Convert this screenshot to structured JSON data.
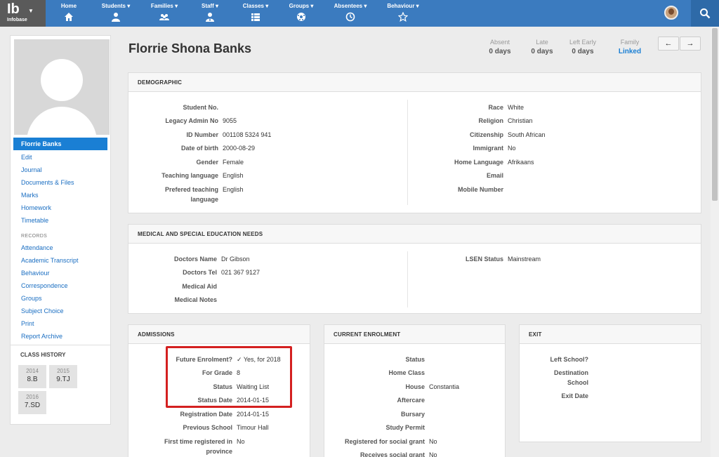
{
  "app": {
    "logo": "Ib",
    "logo_sub": "Infobase"
  },
  "nav": [
    {
      "label": "Home",
      "icon": "home-icon"
    },
    {
      "label": "Students ▾",
      "icon": "user-icon"
    },
    {
      "label": "Families ▾",
      "icon": "family-icon"
    },
    {
      "label": "Staff ▾",
      "icon": "staff-icon"
    },
    {
      "label": "Classes ▾",
      "icon": "list-icon"
    },
    {
      "label": "Groups ▾",
      "icon": "soccer-ball-icon"
    },
    {
      "label": "Absentees ▾",
      "icon": "clock-icon"
    },
    {
      "label": "Behaviour ▾",
      "icon": "star-icon"
    }
  ],
  "sidebar": {
    "active": "Florrie Banks",
    "links": [
      "Edit",
      "Journal",
      "Documents & Files",
      "Marks",
      "Homework",
      "Timetable"
    ],
    "records_title": "RECORDS",
    "records": [
      "Attendance",
      "Academic Transcript",
      "Behaviour",
      "Correspondence",
      "Groups",
      "Subject Choice",
      "Print",
      "Report Archive"
    ],
    "class_history_title": "CLASS HISTORY",
    "class_history": [
      {
        "year": "2014",
        "class": "8.B"
      },
      {
        "year": "2015",
        "class": "9.TJ"
      },
      {
        "year": "2016",
        "class": "7.SD"
      }
    ]
  },
  "header": {
    "name": "Florrie Shona Banks",
    "stats": [
      {
        "label": "Absent",
        "value": "0 days"
      },
      {
        "label": "Late",
        "value": "0 days"
      },
      {
        "label": "Left Early",
        "value": "0 days"
      },
      {
        "label": "Family",
        "value": "Linked"
      }
    ],
    "prev": "←",
    "next": "→"
  },
  "demographic": {
    "title": "DEMOGRAPHIC",
    "left": [
      {
        "label": "Student No.",
        "value": ""
      },
      {
        "label": "Legacy Admin No",
        "value": "9055"
      },
      {
        "label": "ID Number",
        "value": "001108 5324 941"
      },
      {
        "label": "Date of birth",
        "value": "2000-08-29"
      },
      {
        "label": "Gender",
        "value": "Female"
      },
      {
        "label": "Teaching language",
        "value": "English"
      },
      {
        "label": "Prefered teaching language",
        "value": "English"
      }
    ],
    "right": [
      {
        "label": "Race",
        "value": "White"
      },
      {
        "label": "Religion",
        "value": "Christian"
      },
      {
        "label": "Citizenship",
        "value": "South African"
      },
      {
        "label": "Immigrant",
        "value": "No"
      },
      {
        "label": "Home Language",
        "value": "Afrikaans"
      },
      {
        "label": "Email",
        "value": ""
      },
      {
        "label": "Mobile Number",
        "value": ""
      }
    ]
  },
  "medical": {
    "title": "MEDICAL AND SPECIAL EDUCATION NEEDS",
    "left": [
      {
        "label": "Doctors Name",
        "value": "Dr Gibson"
      },
      {
        "label": "Doctors Tel",
        "value": "021 367 9127"
      },
      {
        "label": "Medical Aid",
        "value": ""
      },
      {
        "label": "Medical Notes",
        "value": ""
      }
    ],
    "right": [
      {
        "label": "LSEN Status",
        "value": "Mainstream"
      }
    ]
  },
  "admissions": {
    "title": "ADMISSIONS",
    "rows": [
      {
        "label": "Future Enrolment?",
        "value": "✓ Yes, for 2018"
      },
      {
        "label": "For Grade",
        "value": "8"
      },
      {
        "label": "Status",
        "value": "Waiting List"
      },
      {
        "label": "Status Date",
        "value": "2014-01-15"
      },
      {
        "label": "Registration Date",
        "value": "2014-01-15"
      },
      {
        "label": "Previous School",
        "value": "Timour Hall"
      },
      {
        "label": "First time registered in province",
        "value": "No"
      }
    ]
  },
  "enrolment": {
    "title": "CURRENT ENROLMENT",
    "rows": [
      {
        "label": "Status",
        "value": ""
      },
      {
        "label": "Home Class",
        "value": ""
      },
      {
        "label": "House",
        "value": "Constantia"
      },
      {
        "label": "Aftercare",
        "value": ""
      },
      {
        "label": "Bursary",
        "value": ""
      },
      {
        "label": "Study Permit",
        "value": ""
      },
      {
        "label": "Registered for social grant",
        "value": "No"
      },
      {
        "label": "Receives social grant",
        "value": "No"
      }
    ]
  },
  "exit": {
    "title": "EXIT",
    "rows": [
      {
        "label": "Left School?",
        "value": ""
      },
      {
        "label": "Destination School",
        "value": ""
      },
      {
        "label": "Exit Date",
        "value": ""
      }
    ]
  }
}
